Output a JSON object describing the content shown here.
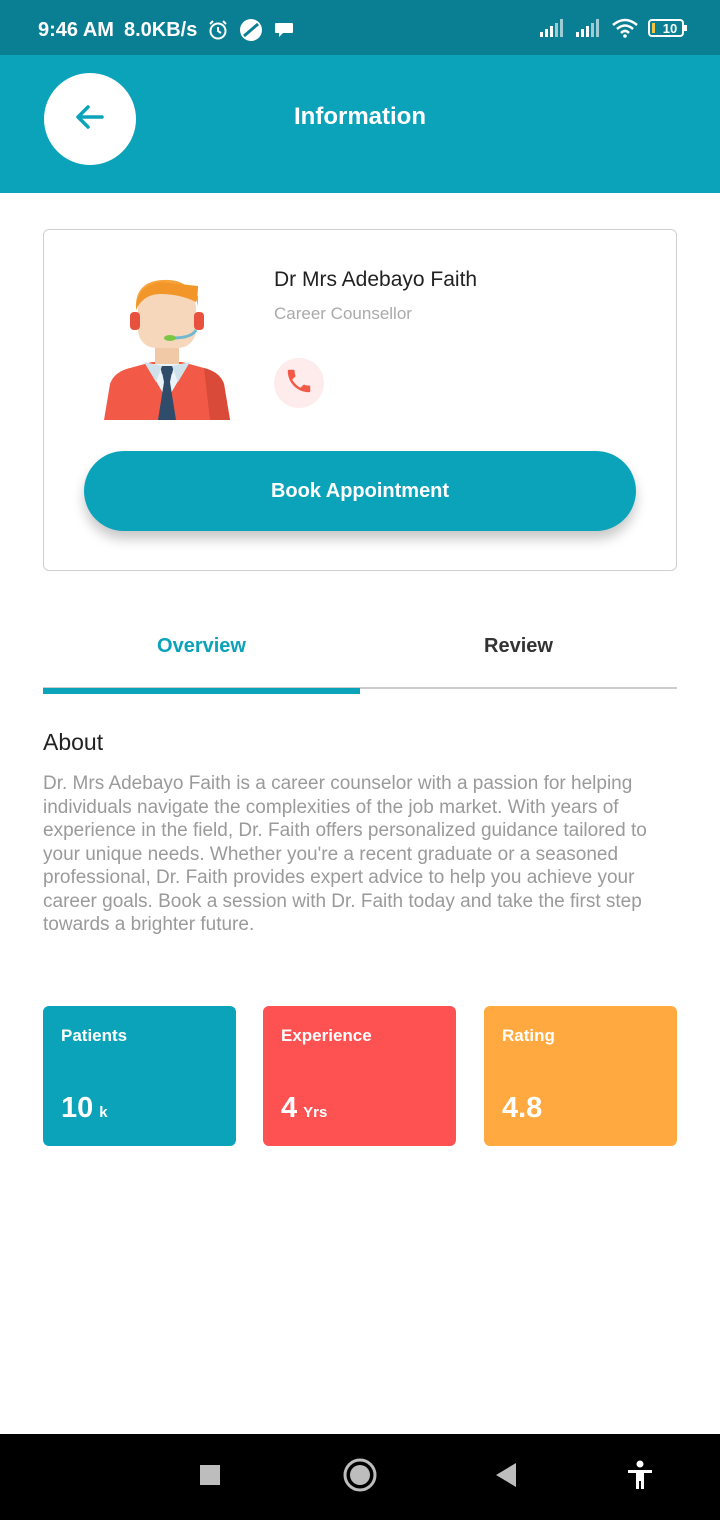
{
  "status_bar": {
    "time": "9:46 AM",
    "speed": "8.0KB/s",
    "battery": "10",
    "icons": [
      "alarm-icon",
      "disc-icon",
      "chat-bubble-icon",
      "signal-icon",
      "signal-icon",
      "wifi-icon",
      "battery-icon"
    ]
  },
  "app_bar": {
    "title": "Information",
    "back_icon": "arrow-left-icon"
  },
  "profile": {
    "name": "Dr Mrs Adebayo Faith",
    "role": "Career Counsellor",
    "call_icon": "phone-icon",
    "book_label": "Book Appointment"
  },
  "tabs": {
    "items": [
      {
        "label": "Overview",
        "active": true
      },
      {
        "label": "Review",
        "active": false
      }
    ]
  },
  "about": {
    "title": "About",
    "text": "Dr. Mrs Adebayo Faith is a career counselor with a passion for helping individuals navigate the complexities of the job market. With years of experience in the field, Dr. Faith offers personalized guidance tailored to your unique needs. Whether you're a recent graduate or a seasoned professional, Dr. Faith provides expert advice to help you achieve your career goals. Book a session with Dr. Faith today and take the first step towards a brighter future."
  },
  "stats": {
    "patients": {
      "label": "Patients",
      "value": "10",
      "unit": "k",
      "color": "#0ba3ba"
    },
    "experience": {
      "label": "Experience",
      "value": "4",
      "unit": "Yrs",
      "color": "#fe5252"
    },
    "rating": {
      "label": "Rating",
      "value": "4.8",
      "unit": "",
      "color": "#ffa940"
    }
  },
  "colors": {
    "accent": "#0ba3ba",
    "status_bar": "#0a7f94"
  },
  "nav_bar": {
    "icons": [
      "square-recents-icon",
      "circle-home-icon",
      "triangle-back-icon",
      "accessibility-icon"
    ]
  }
}
